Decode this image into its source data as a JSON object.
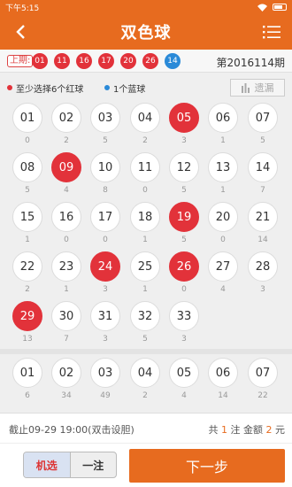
{
  "status": {
    "time": "下午5:15"
  },
  "header": {
    "title": "双色球"
  },
  "last": {
    "label": "上期:",
    "red": [
      "01",
      "11",
      "16",
      "17",
      "20",
      "26"
    ],
    "blue": [
      "14"
    ],
    "period": "第2016114期"
  },
  "hints": {
    "red": "至少选择6个红球",
    "blue": "1个蓝球",
    "omit_button": "遗漏"
  },
  "colors": {
    "brand": "#e76b1f",
    "red": "#e2323a",
    "blue": "#2a8ad8"
  },
  "red_balls": [
    {
      "n": "01",
      "o": "0",
      "sel": false
    },
    {
      "n": "02",
      "o": "2",
      "sel": false
    },
    {
      "n": "03",
      "o": "5",
      "sel": false
    },
    {
      "n": "04",
      "o": "2",
      "sel": false
    },
    {
      "n": "05",
      "o": "3",
      "sel": true
    },
    {
      "n": "06",
      "o": "1",
      "sel": false
    },
    {
      "n": "07",
      "o": "5",
      "sel": false
    },
    {
      "n": "08",
      "o": "5",
      "sel": false
    },
    {
      "n": "09",
      "o": "4",
      "sel": true
    },
    {
      "n": "10",
      "o": "8",
      "sel": false
    },
    {
      "n": "11",
      "o": "0",
      "sel": false
    },
    {
      "n": "12",
      "o": "5",
      "sel": false
    },
    {
      "n": "13",
      "o": "1",
      "sel": false
    },
    {
      "n": "14",
      "o": "7",
      "sel": false
    },
    {
      "n": "15",
      "o": "1",
      "sel": false
    },
    {
      "n": "16",
      "o": "0",
      "sel": false
    },
    {
      "n": "17",
      "o": "0",
      "sel": false
    },
    {
      "n": "18",
      "o": "1",
      "sel": false
    },
    {
      "n": "19",
      "o": "5",
      "sel": true
    },
    {
      "n": "20",
      "o": "0",
      "sel": false
    },
    {
      "n": "21",
      "o": "14",
      "sel": false
    },
    {
      "n": "22",
      "o": "2",
      "sel": false
    },
    {
      "n": "23",
      "o": "1",
      "sel": false
    },
    {
      "n": "24",
      "o": "3",
      "sel": true
    },
    {
      "n": "25",
      "o": "1",
      "sel": false
    },
    {
      "n": "26",
      "o": "0",
      "sel": true
    },
    {
      "n": "27",
      "o": "4",
      "sel": false
    },
    {
      "n": "28",
      "o": "3",
      "sel": false
    },
    {
      "n": "29",
      "o": "13",
      "sel": true
    },
    {
      "n": "30",
      "o": "7",
      "sel": false
    },
    {
      "n": "31",
      "o": "3",
      "sel": false
    },
    {
      "n": "32",
      "o": "5",
      "sel": false
    },
    {
      "n": "33",
      "o": "3",
      "sel": false
    }
  ],
  "blue_balls": [
    {
      "n": "01",
      "o": "6"
    },
    {
      "n": "02",
      "o": "34"
    },
    {
      "n": "03",
      "o": "49"
    },
    {
      "n": "04",
      "o": "2"
    },
    {
      "n": "05",
      "o": "4"
    },
    {
      "n": "06",
      "o": "14"
    },
    {
      "n": "07",
      "o": "22"
    }
  ],
  "footer": {
    "deadline": "截止09-29 19:00(双击设胆)",
    "sum_prefix": "共",
    "count": "1",
    "sum_mid": "注 金额",
    "amount": "2",
    "sum_suffix": "元",
    "random_label": "机选",
    "single_label": "一注",
    "next_label": "下一步"
  }
}
